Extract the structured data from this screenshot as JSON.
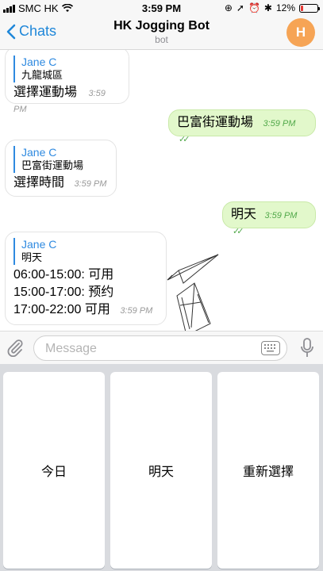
{
  "status_bar": {
    "carrier": "SMC HK",
    "time": "3:59 PM",
    "battery": "12%"
  },
  "nav": {
    "back_label": "Chats",
    "title": "HK Jogging Bot",
    "subtitle": "bot",
    "avatar_initial": "H"
  },
  "messages": [
    {
      "dir": "in",
      "reply_name": "Jane C",
      "reply_quote": "九龍城區",
      "lines": [
        "選擇運動場"
      ],
      "time": "3:59 PM"
    },
    {
      "dir": "out",
      "lines": [
        "巴富街運動場"
      ],
      "time": "3:59 PM"
    },
    {
      "dir": "in",
      "reply_name": "Jane C",
      "reply_quote": "巴富街運動場",
      "lines": [
        "選擇時間"
      ],
      "time": "3:59 PM"
    },
    {
      "dir": "out",
      "lines": [
        "明天"
      ],
      "time": "3:59 PM"
    },
    {
      "dir": "in",
      "reply_name": "Jane C",
      "reply_quote": "明天",
      "lines": [
        "06:00-15:00: 可用",
        "15:00-17:00: 预约",
        "17:00-22:00 可用"
      ],
      "time": "3:59 PM"
    }
  ],
  "composer": {
    "placeholder": "Message"
  },
  "keyboard": {
    "buttons": [
      "今日",
      "明天",
      "重新選擇"
    ]
  }
}
